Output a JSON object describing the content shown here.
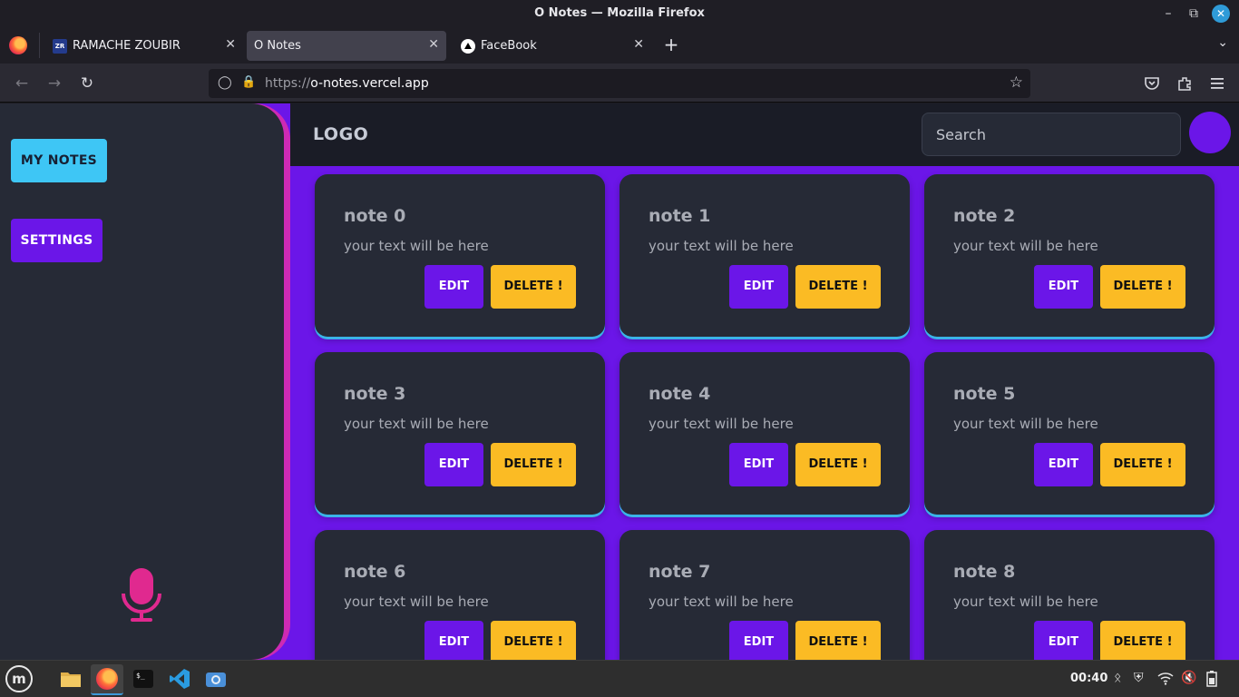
{
  "window": {
    "title": "O Notes — Mozilla Firefox"
  },
  "tabs": [
    {
      "label": "RAMACHE ZOUBIR",
      "favicon": "ZR"
    },
    {
      "label": "O Notes"
    },
    {
      "label": "FaceBook"
    }
  ],
  "navbar": {
    "url_protocol": "https://",
    "url_host": "o-notes.vercel.app"
  },
  "app": {
    "sidebar": {
      "my_notes": "MY NOTES",
      "settings": "SETTINGS"
    },
    "header": {
      "logo": "LOGO",
      "search_placeholder": "Search"
    },
    "notes": [
      {
        "title": "note 0",
        "text": "your text will be here",
        "edit": "EDIT",
        "delete": "DELETE !"
      },
      {
        "title": "note 1",
        "text": "your text will be here",
        "edit": "EDIT",
        "delete": "DELETE !"
      },
      {
        "title": "note 2",
        "text": "your text will be here",
        "edit": "EDIT",
        "delete": "DELETE !"
      },
      {
        "title": "note 3",
        "text": "your text will be here",
        "edit": "EDIT",
        "delete": "DELETE !"
      },
      {
        "title": "note 4",
        "text": "your text will be here",
        "edit": "EDIT",
        "delete": "DELETE !"
      },
      {
        "title": "note 5",
        "text": "your text will be here",
        "edit": "EDIT",
        "delete": "DELETE !"
      },
      {
        "title": "note 6",
        "text": "your text will be here",
        "edit": "EDIT",
        "delete": "DELETE !"
      },
      {
        "title": "note 7",
        "text": "your text will be here",
        "edit": "EDIT",
        "delete": "DELETE !"
      },
      {
        "title": "note 8",
        "text": "your text will be here",
        "edit": "EDIT",
        "delete": "DELETE !"
      }
    ]
  },
  "taskbar": {
    "clock": "00:40"
  },
  "colors": {
    "accent": "#6b16e8",
    "sidebar_border": "#ce2ab4",
    "my_notes_btn": "#3ec6f5",
    "delete_btn": "#fbbb24",
    "card_bg": "#262a36"
  }
}
